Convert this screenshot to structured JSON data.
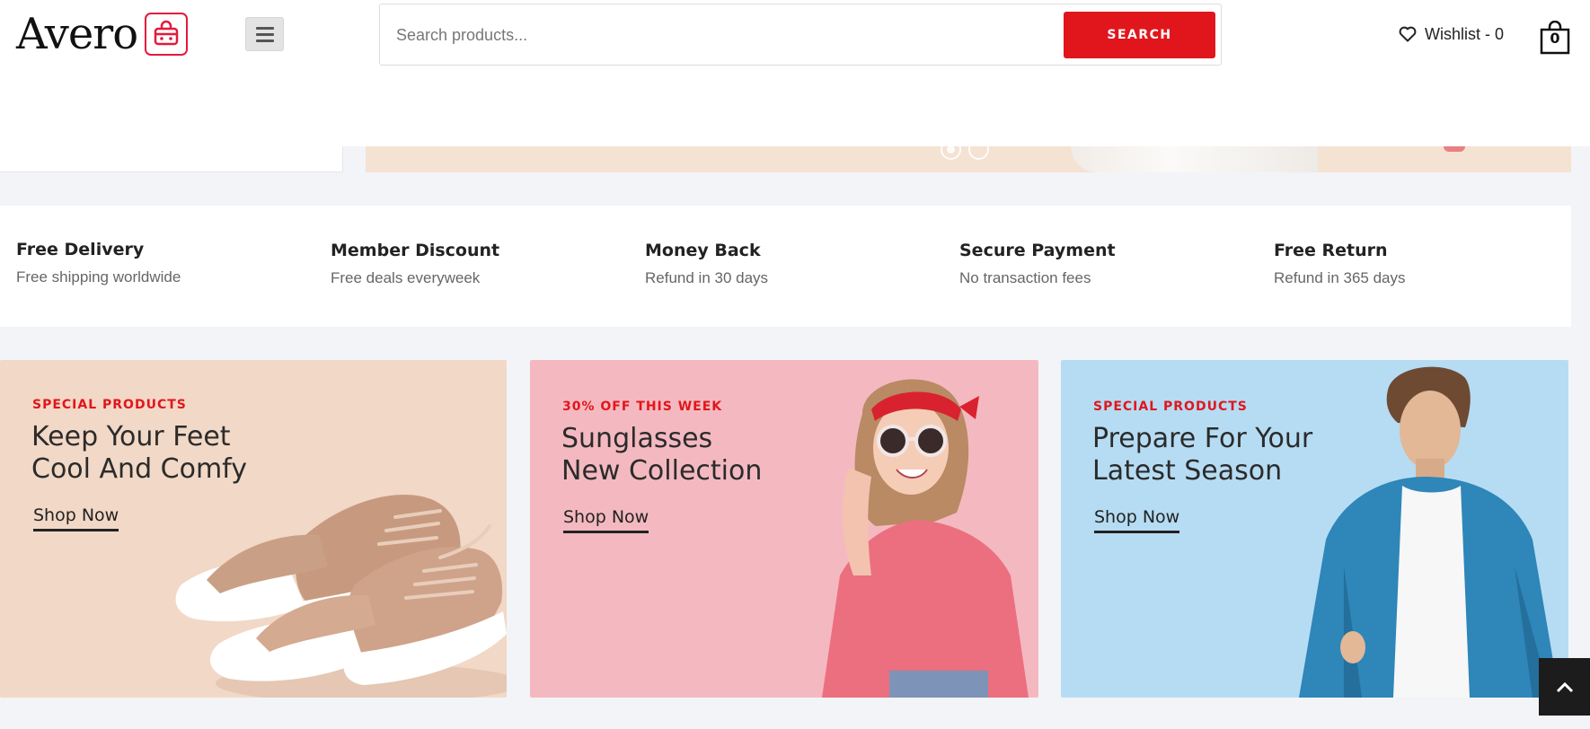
{
  "header": {
    "logo_text": "Avero",
    "logo_icon": "shopping-bag-icon",
    "menu_icon": "hamburger-icon",
    "search": {
      "placeholder": "Search products...",
      "value": "",
      "button_label": "SEARCH"
    },
    "wishlist_label": "Wishlist - 0",
    "cart_count": "0"
  },
  "hero": {
    "slides_total": 2,
    "active_slide": 1
  },
  "features": [
    {
      "title": "Free Delivery",
      "subtitle": "Free shipping worldwide"
    },
    {
      "title": "Member Discount",
      "subtitle": "Free deals everyweek"
    },
    {
      "title": "Money Back",
      "subtitle": "Refund in 30 days"
    },
    {
      "title": "Secure Payment",
      "subtitle": "No transaction fees"
    },
    {
      "title": "Free Return",
      "subtitle": "Refund in 365 days"
    }
  ],
  "banners": [
    {
      "tag": "SPECIAL PRODUCTS",
      "title_line1": "Keep Your Feet",
      "title_line2": "Cool And Comfy",
      "link": "Shop Now",
      "bg": "#f2d8c6"
    },
    {
      "tag": "30% OFF THIS WEEK",
      "title_line1": "Sunglasses",
      "title_line2": "New Collection",
      "link": "Shop Now",
      "bg": "#f4b9c0"
    },
    {
      "tag": "SPECIAL PRODUCTS",
      "title_line1": "Prepare For Your",
      "title_line2": "Latest Season",
      "link": "Shop Now",
      "bg": "#b6dcf3"
    }
  ],
  "colors": {
    "accent": "#e1161d",
    "page_bg": "#f3f4f8"
  },
  "back_to_top_icon": "chevron-up-icon"
}
